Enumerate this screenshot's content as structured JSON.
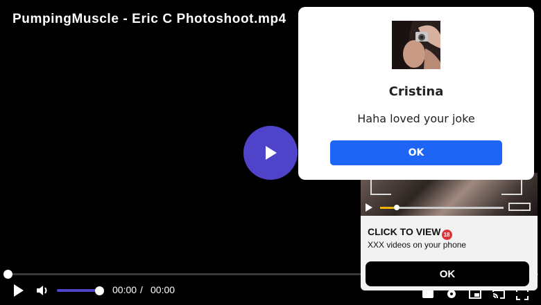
{
  "video": {
    "title": "PumpingMuscle - Eric C Photoshoot.mp4",
    "current_time": "00:00",
    "separator": "/",
    "duration": "00:00",
    "progress": 0,
    "volume": 1.0,
    "accent_color": "#4f44c9"
  },
  "controls": {
    "left_icons": [
      "play-icon",
      "volume-icon"
    ],
    "right_icons": [
      "captions-icon",
      "settings-icon",
      "picture-in-picture-icon",
      "cast-icon",
      "fullscreen-icon"
    ]
  },
  "popup": {
    "name": "Cristina",
    "message": "Haha loved your joke",
    "ok_label": "OK",
    "button_color": "#1e64f5"
  },
  "ad": {
    "headline": "CLICK TO VIEW",
    "badge": "18",
    "subtext": "XXX videos on your phone",
    "ok_label": "OK"
  }
}
